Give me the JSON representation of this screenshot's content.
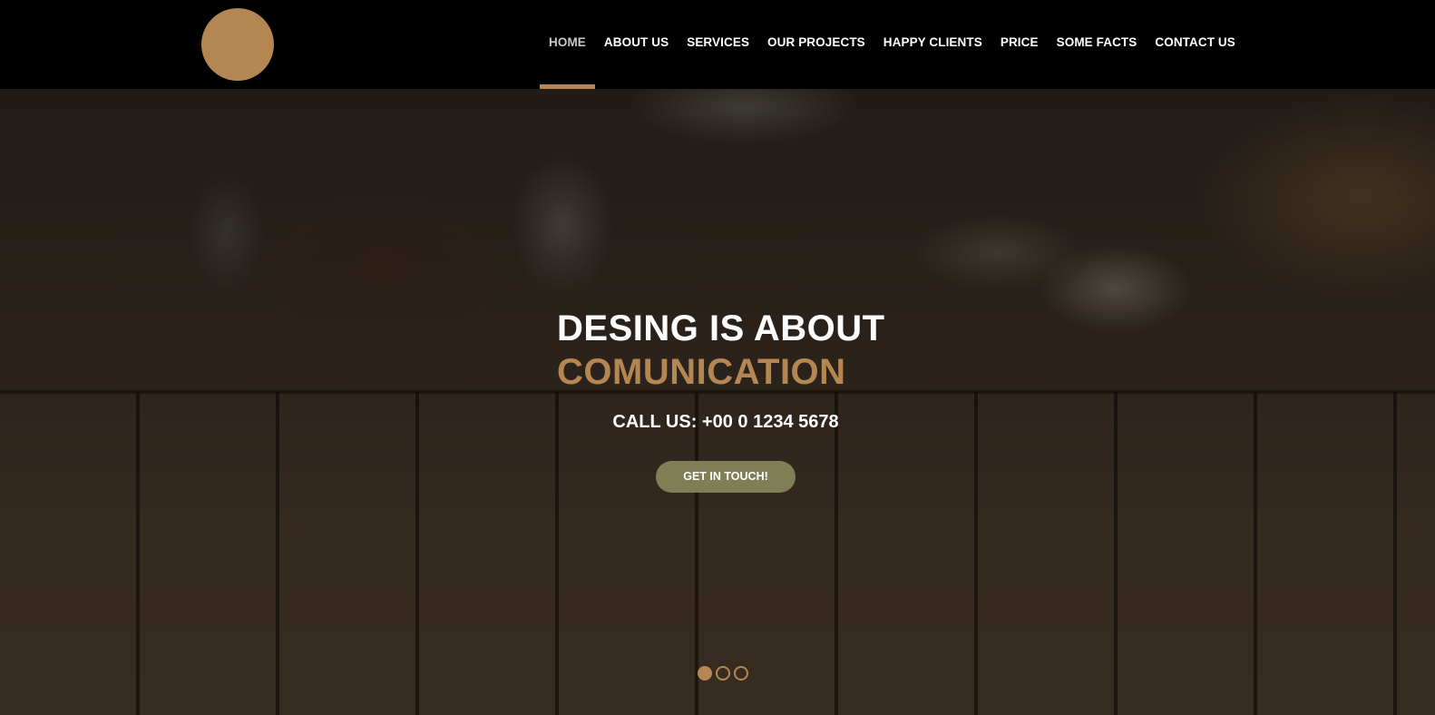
{
  "colors": {
    "accent": "#b48651",
    "cta": "#7f7e55",
    "header_bg": "#000000"
  },
  "header": {
    "logo": "circle-logo-icon",
    "nav": [
      {
        "label": "HOME",
        "active": true
      },
      {
        "label": "ABOUT US"
      },
      {
        "label": "SERVICES"
      },
      {
        "label": "OUR PROJECTS"
      },
      {
        "label": "HAPPY CLIENTS"
      },
      {
        "label": "PRICE"
      },
      {
        "label": "SOME FACTS"
      },
      {
        "label": "CONTACT US"
      }
    ]
  },
  "hero": {
    "title_line1": "DESING IS ABOUT",
    "title_line2": "COMUNICATION",
    "call": "CALL US: +00 0 1234 5678",
    "cta": "GET IN TOUCH!",
    "slides": 3,
    "active_slide": 1
  }
}
